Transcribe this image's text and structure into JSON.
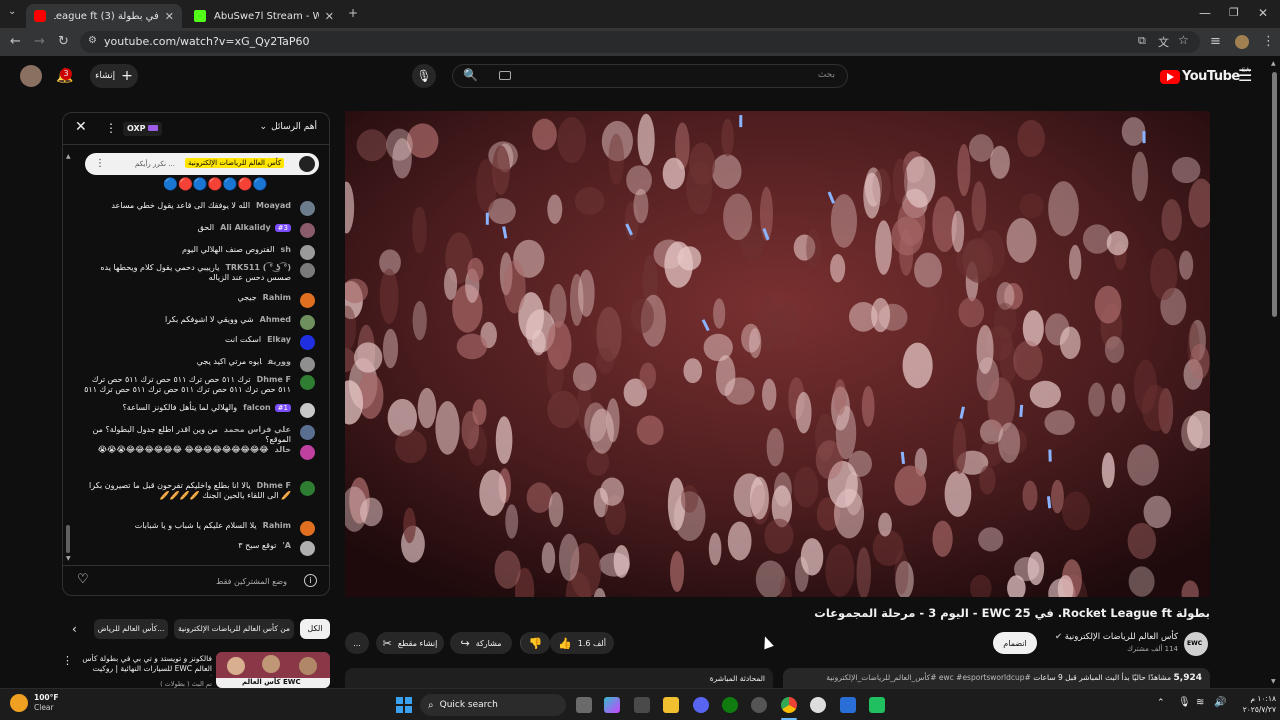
{
  "browser": {
    "tabs": [
      {
        "title": "في بطولة Rocket League ft (3)",
        "favicon_color": "#ff0000",
        "active": true
      },
      {
        "title": "AbuSwe7l Stream - Watch Live",
        "favicon_color": "#53fc18",
        "active": false
      }
    ],
    "url": "youtube.com/watch?v=xG_Qy2TaP60",
    "new_tab_label": "+"
  },
  "masthead": {
    "logo_text": "YouTube",
    "region": "SA",
    "search_placeholder": "بحث",
    "create_label": "إنشاء",
    "notif_count": "3"
  },
  "chat": {
    "header_title": "أهم الرسائل",
    "oxp_badge": "OXP",
    "pinned_text": "كأس العالم للرياضات الإلكترونية",
    "pinned_more": "نكرر رأيكم ...",
    "input_placeholder": "وضع المشتركين فقط",
    "messages": [
      {
        "name": "Moayad",
        "text": "الله لا يوفقك الى قاعد يقول خطي مساعد",
        "avatar": "#6b7d8c"
      },
      {
        "name": "Ali Alkalidy",
        "badge": "#3",
        "text": "الحق",
        "avatar": "#8a5c6b"
      },
      {
        "name": "sh",
        "text": "الفتروص صنف الهلالي اليوم",
        "avatar": "#9a9a9a"
      },
      {
        "name": "TRK511 ( ͡° ͜ʖ ͡°)",
        "text": "يارييبي دحمي يقول كلام ويحطها يده صسس دحس عند الزياله",
        "avatar": "#7a7a7a"
      },
      {
        "name": "Rahim",
        "text": "جيجي",
        "avatar": "#e07020"
      },
      {
        "name": "Ahmed",
        "text": "شي وويقي لا اشوفكم بكرا",
        "avatar": "#6f8f5f"
      },
      {
        "name": "Elkay",
        "text": "اسكت انت",
        "avatar": "#2030e0"
      },
      {
        "name": "ووريف",
        "text": "ايوه مرتي اكيد يجي",
        "avatar": "#8f8f8f"
      },
      {
        "name": "Dhme F",
        "text": "ترك ٥١١ حص ترك ٥١١ حص ترك ٥١١ حص ترك ٥١١ حص ترك ٥١١ حص ترك ٥١١ حص ترك ٥١١ حص ترك ٥١١",
        "avatar": "#2e7d32"
      },
      {
        "name": "falcon",
        "badge": "#1",
        "text": "والهلالي لما يتأهل فالكونز الساعة؟",
        "avatar": "#c8c8c8",
        "prefix": "يوسفي"
      },
      {
        "name": "علي فراس محمد",
        "text": "من وين اقدر اطلع جدول البطولة؟ من الموقع؟",
        "avatar": "#5a6f8f"
      },
      {
        "name": "خالد",
        "text": "😂😂😂😂😂😂😂😂😂 😂😂😂😂😂😂😭😭😭",
        "avatar": "#c040a0"
      },
      {
        "name": "Dhme F",
        "text": "يالا انا بطلع واخليكم تفرحون قبل ما تصيرون بكرا 🥖 الى اللقاء يالحين الجنك 🥖🥖🥖🥖",
        "avatar": "#2e7d32"
      },
      {
        "name": "Rahim",
        "text": "يلا السلام عليكم يا شباب و يا شبابات",
        "avatar": "#e07020"
      },
      {
        "name": "A'",
        "text": "توقع سبح ٣",
        "avatar": "#b0b0b0"
      }
    ]
  },
  "video": {
    "title": "بطولة Rocket League ft. في EWC 25 - اليوم 3 - مرحلة المجموعات",
    "channel": "كأس العالم للرياضات الإلكترونية",
    "subscribers": "114 ألف مشترك",
    "join_label": "انضمام",
    "likes": "1.6 ألف",
    "share_label": "مشاركة",
    "clip_label": "إنشاء مقطع",
    "more_label": "...",
    "viewers": "5,924",
    "viewers_text": "مشاهدًا حاليًا بدأ البث المباشر قبل 9 ساعات",
    "hashtags": "#ewc #esportsworldcup #كأس_العالم_للرياضات_الإلكترونية",
    "live_chat_label": "المحادثة المباشرة"
  },
  "filters": {
    "chips": [
      "الكل",
      "من كأس العالم للرياضات الإلكترونية",
      "كأس العالم للرياض..."
    ]
  },
  "recommended": {
    "title": "فالكونز و تويستد و تي بي في بطولة كأس العالم EWC للسيارات النهائية | روكيت ليق",
    "meta": "تم البث ( بطولات )",
    "thumb_label": "كأس العالم EWC"
  },
  "taskbar": {
    "weather_temp": "100°F",
    "weather_desc": "Clear",
    "search_label": "Quick search",
    "time": "١٠:١٨ م",
    "date": "٢٠٢٥/٧/٢٧"
  }
}
